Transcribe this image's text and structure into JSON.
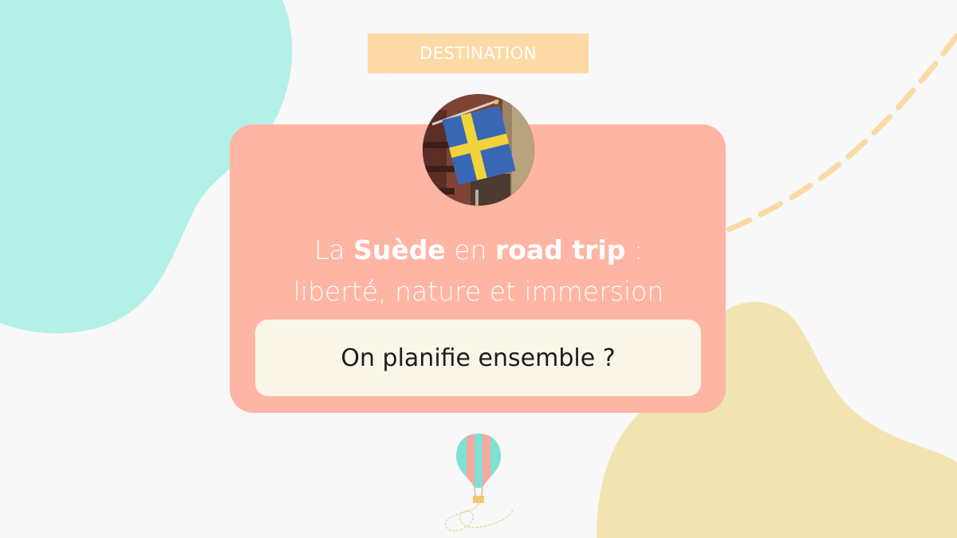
{
  "colors": {
    "background": "#f8f8f8",
    "teal_blob": "#b3f0e8",
    "yellow_blob": "#f2e4b0",
    "card": "#ffb5a3",
    "tag": "#fdd9a6",
    "cta_background": "#f9f6e9",
    "dashed_line": "#fdd9a6",
    "balloon_teal": "#7fe0d4",
    "balloon_pink": "#f7a8a0"
  },
  "tag": {
    "label": "DESTINATION"
  },
  "photo": {
    "subject": "swedish-flag"
  },
  "headline": {
    "line1_pre": "La ",
    "line1_bold1": "Suède",
    "line1_mid": " en ",
    "line1_bold2": "road trip",
    "line1_post": " :",
    "line2": "liberté, nature et immersion"
  },
  "cta": {
    "label": "On planifie ensemble ?"
  },
  "decorations": {
    "balloon_icon": "hot-air-balloon-icon"
  }
}
